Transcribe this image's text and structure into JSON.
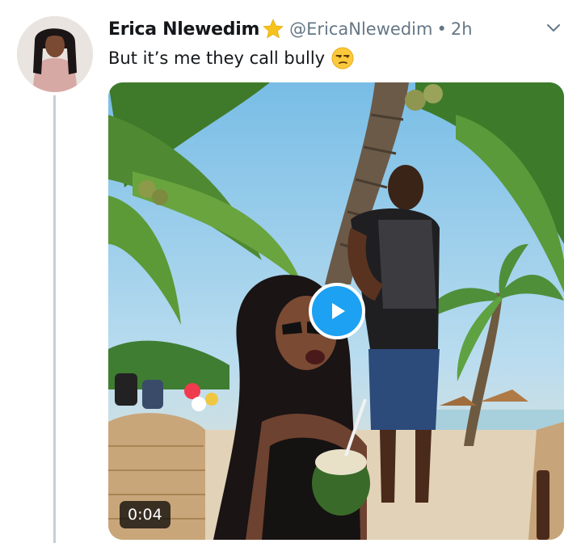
{
  "tweet": {
    "author_name": "Erica Nlewedim",
    "verified_icon": "star-emoji",
    "handle": "@EricaNlewedim",
    "separator": "•",
    "time": "2h",
    "text": "But it’s me they call bully",
    "text_emoji": "unamused-face-emoji",
    "more_icon": "chevron-down-icon"
  },
  "media": {
    "type": "video",
    "duration": "0:04",
    "play_icon": "play-icon"
  },
  "colors": {
    "accent": "#1da1f2",
    "text": "#14171a",
    "secondary": "#657786",
    "thread_line": "#c4cfd6"
  }
}
